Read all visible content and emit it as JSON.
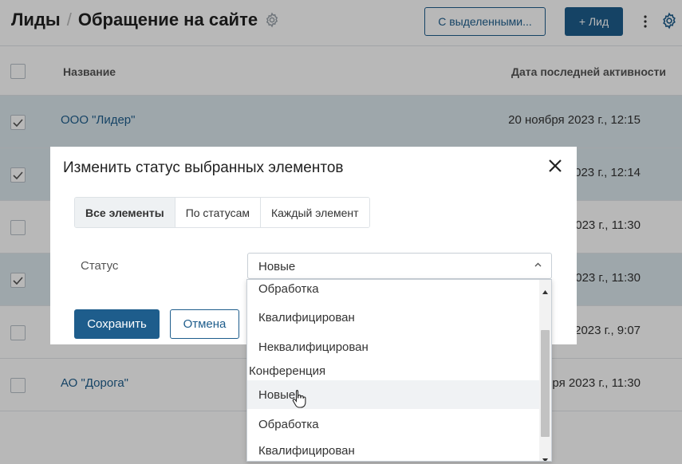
{
  "header": {
    "title": "Лиды",
    "separator": "/",
    "subtitle": "Обращение на сайте",
    "bulk_button": "С выделенными...",
    "add_button": "+ Лид"
  },
  "table": {
    "columns": [
      "Название",
      "Дата последней активности"
    ],
    "rows": [
      {
        "name": "ООО \"Лидер\"",
        "date": "20 ноября 2023 г., 12:15",
        "selected": true
      },
      {
        "name": "",
        "date": "2023 г., 12:14",
        "selected": true
      },
      {
        "name": "",
        "date": "2023 г., 11:30",
        "selected": false
      },
      {
        "name": "",
        "date": "2023 г., 11:30",
        "selected": true
      },
      {
        "name": "",
        "date": "2023 г., 9:07",
        "selected": false
      },
      {
        "name": "АО \"Дорога\"",
        "date": "ря 2023 г., 11:30",
        "selected": false
      }
    ]
  },
  "modal": {
    "title": "Изменить статус выбранных элементов",
    "tabs": [
      {
        "label": "Все элементы",
        "active": true
      },
      {
        "label": "По статусам",
        "active": false
      },
      {
        "label": "Каждый элемент",
        "active": false
      }
    ],
    "status_label": "Статус",
    "status_value": "Новые",
    "save_button": "Сохранить",
    "cancel_button": "Отмена"
  },
  "dropdown": {
    "items": [
      {
        "label": "Обработка",
        "type": "option"
      },
      {
        "label": "Квалифицирован",
        "type": "option"
      },
      {
        "label": "Неквалифицирован",
        "type": "option"
      },
      {
        "label": "Конференция",
        "type": "group"
      },
      {
        "label": "Новые",
        "type": "option",
        "hover": true
      },
      {
        "label": "Обработка",
        "type": "option"
      },
      {
        "label": "Квалифицирован",
        "type": "option"
      }
    ]
  },
  "colors": {
    "primary": "#1e5d8c",
    "row_selected": "#dce8ee",
    "overlay": "rgba(0,0,0,0.28)"
  },
  "icons": {
    "title_gear": "gear-icon",
    "header_gear": "gear-icon",
    "kebab": "kebab-menu-icon",
    "close": "close-icon",
    "select_chevron": "chevron-up-icon",
    "checkmark": "checkmark-icon",
    "cursor": "hand-cursor-icon"
  }
}
